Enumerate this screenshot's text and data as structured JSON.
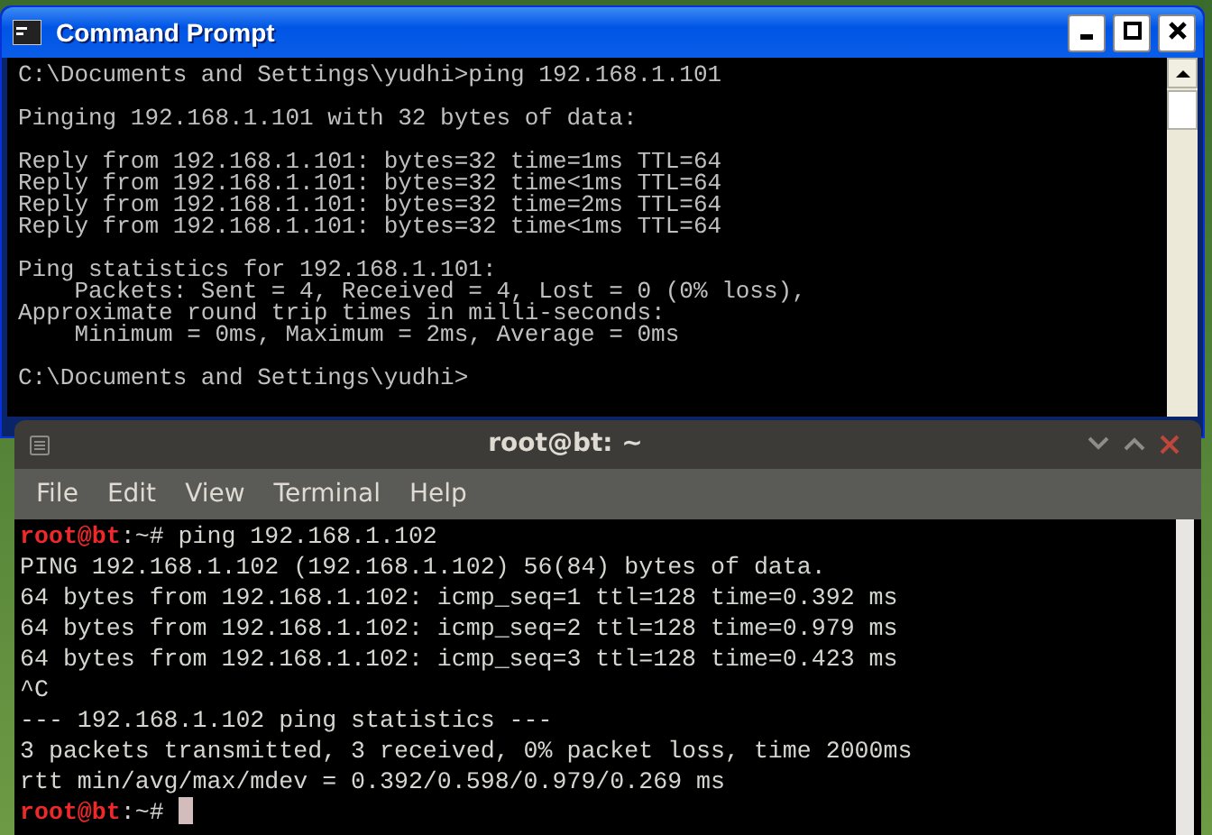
{
  "cmd_window": {
    "title": "Command Prompt",
    "blocks": [
      [
        "C:\\Documents and Settings\\yudhi>ping 192.168.1.101"
      ],
      [
        "Pinging 192.168.1.101 with 32 bytes of data:"
      ],
      [
        "Reply from 192.168.1.101: bytes=32 time=1ms TTL=64",
        "Reply from 192.168.1.101: bytes=32 time<1ms TTL=64",
        "Reply from 192.168.1.101: bytes=32 time=2ms TTL=64",
        "Reply from 192.168.1.101: bytes=32 time<1ms TTL=64"
      ],
      [
        "Ping statistics for 192.168.1.101:",
        "    Packets: Sent = 4, Received = 4, Lost = 0 (0% loss),",
        "Approximate round trip times in milli-seconds:",
        "    Minimum = 0ms, Maximum = 2ms, Average = 0ms"
      ],
      [
        "C:\\Documents and Settings\\yudhi>"
      ]
    ]
  },
  "terminal_window": {
    "title": "root@bt: ~",
    "menu": [
      "File",
      "Edit",
      "View",
      "Terminal",
      "Help"
    ],
    "lines": [
      {
        "kind": "prompt",
        "user": "root@bt",
        "path": ":~#",
        "command": "ping 192.168.1.102",
        "cursor": false
      },
      {
        "kind": "output",
        "text": "PING 192.168.1.102 (192.168.1.102) 56(84) bytes of data."
      },
      {
        "kind": "output",
        "text": "64 bytes from 192.168.1.102: icmp_seq=1 ttl=128 time=0.392 ms"
      },
      {
        "kind": "output",
        "text": "64 bytes from 192.168.1.102: icmp_seq=2 ttl=128 time=0.979 ms"
      },
      {
        "kind": "output",
        "text": "64 bytes from 192.168.1.102: icmp_seq=3 ttl=128 time=0.423 ms"
      },
      {
        "kind": "output",
        "text": "^C"
      },
      {
        "kind": "output",
        "text": "--- 192.168.1.102 ping statistics ---"
      },
      {
        "kind": "output",
        "text": "3 packets transmitted, 3 received, 0% packet loss, time 2000ms"
      },
      {
        "kind": "output",
        "text": "rtt min/avg/max/mdev = 0.392/0.598/0.979/0.269 ms"
      },
      {
        "kind": "prompt",
        "user": "root@bt",
        "path": ":~#",
        "cursor": true
      }
    ]
  }
}
